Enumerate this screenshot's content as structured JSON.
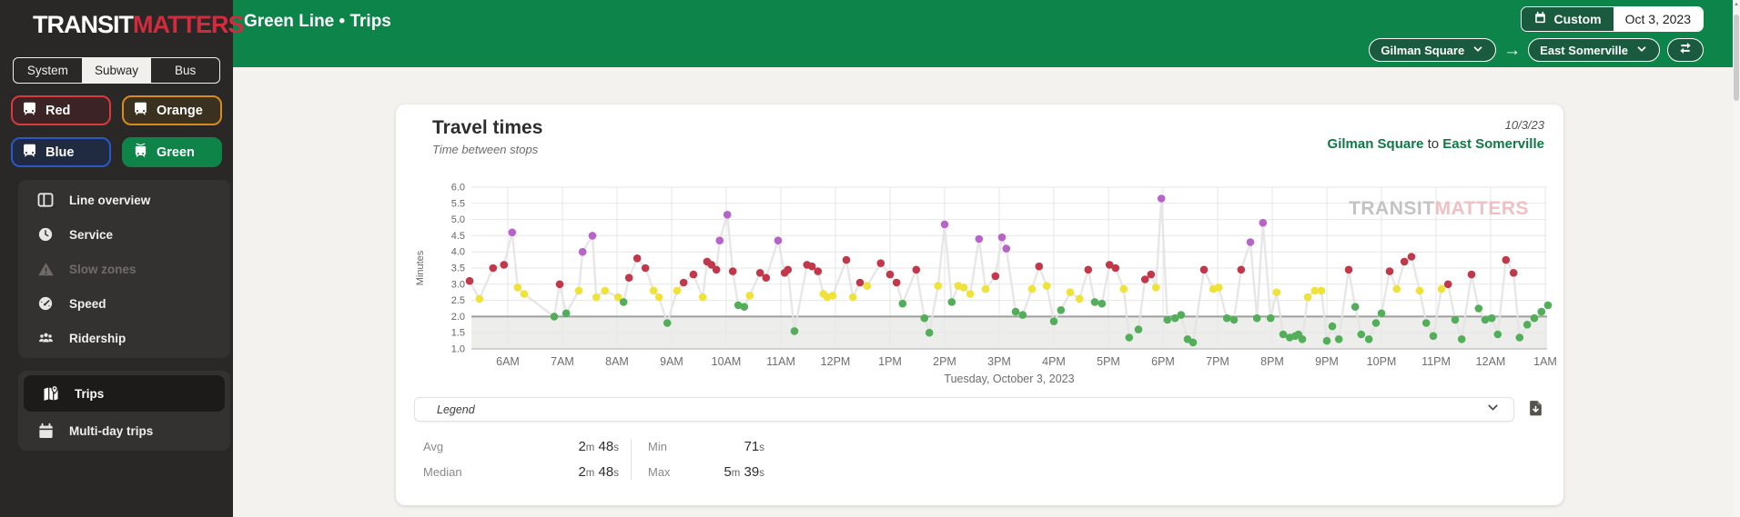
{
  "logo": {
    "part1": "TRANSIT",
    "part2": "MATTERS"
  },
  "sidebar": {
    "mode_tabs": [
      {
        "label": "System",
        "active": false
      },
      {
        "label": "Subway",
        "active": true
      },
      {
        "label": "Bus",
        "active": false
      }
    ],
    "lines": [
      {
        "label": "Red",
        "color": "#d93a40",
        "active": false
      },
      {
        "label": "Orange",
        "color": "#d98b1e",
        "active": false
      },
      {
        "label": "Blue",
        "color": "#2a58c6",
        "active": false
      },
      {
        "label": "Green",
        "color": "#0e8449",
        "active": true
      }
    ],
    "nav": [
      {
        "label": "Line overview",
        "icon": "line-overview-icon",
        "disabled": false
      },
      {
        "label": "Service",
        "icon": "clock-icon",
        "disabled": false
      },
      {
        "label": "Slow zones",
        "icon": "warning-icon",
        "disabled": true
      },
      {
        "label": "Speed",
        "icon": "gauge-icon",
        "disabled": false
      },
      {
        "label": "Ridership",
        "icon": "riders-icon",
        "disabled": false
      }
    ],
    "nav2": [
      {
        "label": "Trips",
        "icon": "map-icon",
        "active": true
      },
      {
        "label": "Multi-day trips",
        "icon": "calendar-icon",
        "active": false
      }
    ]
  },
  "header": {
    "title": "Green Line • Trips",
    "range_toggle_label": "Custom",
    "date_value": "Oct 3, 2023",
    "from_station": "Gilman Square",
    "to_station": "East Somerville",
    "accent_color": "#0d8449"
  },
  "card": {
    "title": "Travel times",
    "subtitle": "Time between stops",
    "date_short": "10/3/23",
    "route_from": "Gilman Square",
    "route_joiner": "to",
    "route_to": "East Somerville",
    "legend_label": "Legend",
    "watermark": {
      "part1": "TRANSIT",
      "part2": "MATTERS"
    },
    "stats": [
      {
        "label": "Avg",
        "value": "2m 48s"
      },
      {
        "label": "Median",
        "value": "2m 48s"
      },
      {
        "label": "Min",
        "value": "71s"
      },
      {
        "label": "Max",
        "value": "5m 39s"
      }
    ]
  },
  "icons": [
    "transitmatters-logo",
    "train-icon",
    "tram-icon",
    "line-overview-icon",
    "clock-icon",
    "warning-icon",
    "gauge-icon",
    "riders-icon",
    "map-icon",
    "calendar-icon",
    "calendar-white-icon",
    "chevron-down-icon",
    "right-arrow-icon",
    "swap-icon",
    "download-icon",
    "scroll-up-icon"
  ],
  "chart_data": {
    "type": "scatter",
    "title": "Travel times",
    "xlabel": "Tuesday, October 3, 2023",
    "ylabel": "Minutes",
    "x_unit": "hour_of_day_24h",
    "xlim": [
      5.0,
      25.35
    ],
    "ylim": [
      1.0,
      6.0
    ],
    "grid": true,
    "y_ticks": [
      1.0,
      1.5,
      2.0,
      2.5,
      3.0,
      3.5,
      4.0,
      4.5,
      5.0,
      5.5,
      6.0
    ],
    "x_ticks": [
      {
        "t": 6,
        "label": "6AM"
      },
      {
        "t": 7,
        "label": "7AM"
      },
      {
        "t": 8,
        "label": "8AM"
      },
      {
        "t": 9,
        "label": "9AM"
      },
      {
        "t": 10,
        "label": "10AM"
      },
      {
        "t": 11,
        "label": "11AM"
      },
      {
        "t": 12,
        "label": "12PM"
      },
      {
        "t": 13,
        "label": "1PM"
      },
      {
        "t": 14,
        "label": "2PM"
      },
      {
        "t": 15,
        "label": "3PM"
      },
      {
        "t": 16,
        "label": "4PM"
      },
      {
        "t": 17,
        "label": "5PM"
      },
      {
        "t": 18,
        "label": "6PM"
      },
      {
        "t": 19,
        "label": "7PM"
      },
      {
        "t": 20,
        "label": "8PM"
      },
      {
        "t": 21,
        "label": "9PM"
      },
      {
        "t": 22,
        "label": "10PM"
      },
      {
        "t": 23,
        "label": "11PM"
      },
      {
        "t": 24,
        "label": "12AM"
      },
      {
        "t": 25,
        "label": "1AM"
      }
    ],
    "benchmark_band": {
      "from": 1.0,
      "to": 2.0
    },
    "color_thresholds": [
      {
        "max": 2.5,
        "color": "#53ae5a"
      },
      {
        "max": 3.0,
        "color": "#efe238"
      },
      {
        "max": 4.0,
        "color": "#c2374a"
      },
      {
        "max": null,
        "color": "#b763c9"
      }
    ],
    "points": [
      [
        5.3,
        3.1
      ],
      [
        5.48,
        2.55
      ],
      [
        5.73,
        3.5
      ],
      [
        5.93,
        3.6
      ],
      [
        6.08,
        4.6
      ],
      [
        6.18,
        2.9
      ],
      [
        6.3,
        2.7
      ],
      [
        6.85,
        2.0
      ],
      [
        6.95,
        3.0
      ],
      [
        7.07,
        2.1
      ],
      [
        7.3,
        2.8
      ],
      [
        7.37,
        4.0
      ],
      [
        7.55,
        4.5
      ],
      [
        7.62,
        2.6
      ],
      [
        7.78,
        2.8
      ],
      [
        8.02,
        2.6
      ],
      [
        8.12,
        2.45
      ],
      [
        8.22,
        3.2
      ],
      [
        8.37,
        3.8
      ],
      [
        8.52,
        3.5
      ],
      [
        8.67,
        2.8
      ],
      [
        8.77,
        2.6
      ],
      [
        8.92,
        1.8
      ],
      [
        9.1,
        2.8
      ],
      [
        9.22,
        3.05
      ],
      [
        9.4,
        3.3
      ],
      [
        9.57,
        2.6
      ],
      [
        9.65,
        3.7
      ],
      [
        9.73,
        3.6
      ],
      [
        9.82,
        3.45
      ],
      [
        9.88,
        4.35
      ],
      [
        10.02,
        5.15
      ],
      [
        10.12,
        3.4
      ],
      [
        10.22,
        2.35
      ],
      [
        10.33,
        2.3
      ],
      [
        10.43,
        2.65
      ],
      [
        10.62,
        3.35
      ],
      [
        10.73,
        3.2
      ],
      [
        10.95,
        4.35
      ],
      [
        11.07,
        3.35
      ],
      [
        11.13,
        3.45
      ],
      [
        11.25,
        1.55
      ],
      [
        11.48,
        3.6
      ],
      [
        11.57,
        3.55
      ],
      [
        11.68,
        3.4
      ],
      [
        11.78,
        2.7
      ],
      [
        11.85,
        2.6
      ],
      [
        11.95,
        2.65
      ],
      [
        12.2,
        3.75
      ],
      [
        12.32,
        2.6
      ],
      [
        12.45,
        3.05
      ],
      [
        12.58,
        2.95
      ],
      [
        12.83,
        3.65
      ],
      [
        13.0,
        3.3
      ],
      [
        13.12,
        3.05
      ],
      [
        13.23,
        2.4
      ],
      [
        13.48,
        3.45
      ],
      [
        13.63,
        1.95
      ],
      [
        13.72,
        1.5
      ],
      [
        13.88,
        2.95
      ],
      [
        14.0,
        4.85
      ],
      [
        14.13,
        2.45
      ],
      [
        14.25,
        2.95
      ],
      [
        14.35,
        2.9
      ],
      [
        14.47,
        2.7
      ],
      [
        14.63,
        4.4
      ],
      [
        14.75,
        2.85
      ],
      [
        14.93,
        3.25
      ],
      [
        15.05,
        4.45
      ],
      [
        15.13,
        4.1
      ],
      [
        15.3,
        2.15
      ],
      [
        15.43,
        2.05
      ],
      [
        15.6,
        2.85
      ],
      [
        15.73,
        3.55
      ],
      [
        15.87,
        2.95
      ],
      [
        16.0,
        1.85
      ],
      [
        16.13,
        2.2
      ],
      [
        16.3,
        2.75
      ],
      [
        16.47,
        2.55
      ],
      [
        16.63,
        3.45
      ],
      [
        16.75,
        2.45
      ],
      [
        16.88,
        2.4
      ],
      [
        17.02,
        3.6
      ],
      [
        17.13,
        3.5
      ],
      [
        17.28,
        2.85
      ],
      [
        17.38,
        1.35
      ],
      [
        17.55,
        1.6
      ],
      [
        17.67,
        3.15
      ],
      [
        17.78,
        3.3
      ],
      [
        17.87,
        2.9
      ],
      [
        17.97,
        5.65
      ],
      [
        18.08,
        1.9
      ],
      [
        18.22,
        1.95
      ],
      [
        18.33,
        2.05
      ],
      [
        18.45,
        1.3
      ],
      [
        18.55,
        1.2
      ],
      [
        18.75,
        3.45
      ],
      [
        18.92,
        2.85
      ],
      [
        19.02,
        2.9
      ],
      [
        19.17,
        1.95
      ],
      [
        19.3,
        1.9
      ],
      [
        19.43,
        3.45
      ],
      [
        19.6,
        4.3
      ],
      [
        19.72,
        1.95
      ],
      [
        19.83,
        4.9
      ],
      [
        19.97,
        1.95
      ],
      [
        20.08,
        2.75
      ],
      [
        20.2,
        1.45
      ],
      [
        20.32,
        1.35
      ],
      [
        20.42,
        1.4
      ],
      [
        20.48,
        1.45
      ],
      [
        20.55,
        1.3
      ],
      [
        20.65,
        2.6
      ],
      [
        20.78,
        2.8
      ],
      [
        20.9,
        2.8
      ],
      [
        21.0,
        1.25
      ],
      [
        21.1,
        1.7
      ],
      [
        21.22,
        1.3
      ],
      [
        21.4,
        3.45
      ],
      [
        21.52,
        2.3
      ],
      [
        21.63,
        1.45
      ],
      [
        21.77,
        1.3
      ],
      [
        21.9,
        1.8
      ],
      [
        22.0,
        2.1
      ],
      [
        22.15,
        3.4
      ],
      [
        22.28,
        2.85
      ],
      [
        22.42,
        3.7
      ],
      [
        22.55,
        3.85
      ],
      [
        22.7,
        2.8
      ],
      [
        22.82,
        1.8
      ],
      [
        22.95,
        1.4
      ],
      [
        23.1,
        2.85
      ],
      [
        23.22,
        3.0
      ],
      [
        23.35,
        1.9
      ],
      [
        23.47,
        1.3
      ],
      [
        23.65,
        3.3
      ],
      [
        23.78,
        2.25
      ],
      [
        23.9,
        1.9
      ],
      [
        24.02,
        1.95
      ],
      [
        24.13,
        1.45
      ],
      [
        24.28,
        3.75
      ],
      [
        24.42,
        3.35
      ],
      [
        24.53,
        1.35
      ],
      [
        24.67,
        1.75
      ],
      [
        24.8,
        1.95
      ],
      [
        24.93,
        2.15
      ],
      [
        25.05,
        2.35
      ]
    ]
  }
}
